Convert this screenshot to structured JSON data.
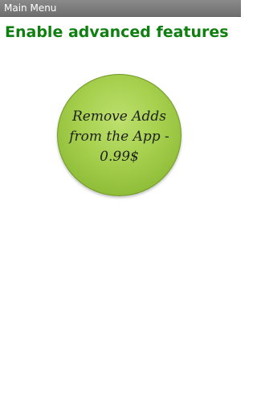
{
  "title_bar": {
    "title": "Main Menu"
  },
  "main": {
    "heading": "Enable advanced features",
    "purchase_button_label": "Remove Adds\nfrom the App -\n0.99$"
  },
  "colors": {
    "title_bar": "#7c7c7c",
    "heading": "#0f7f10",
    "button": "#a6d04e",
    "background": "#ffffff"
  }
}
